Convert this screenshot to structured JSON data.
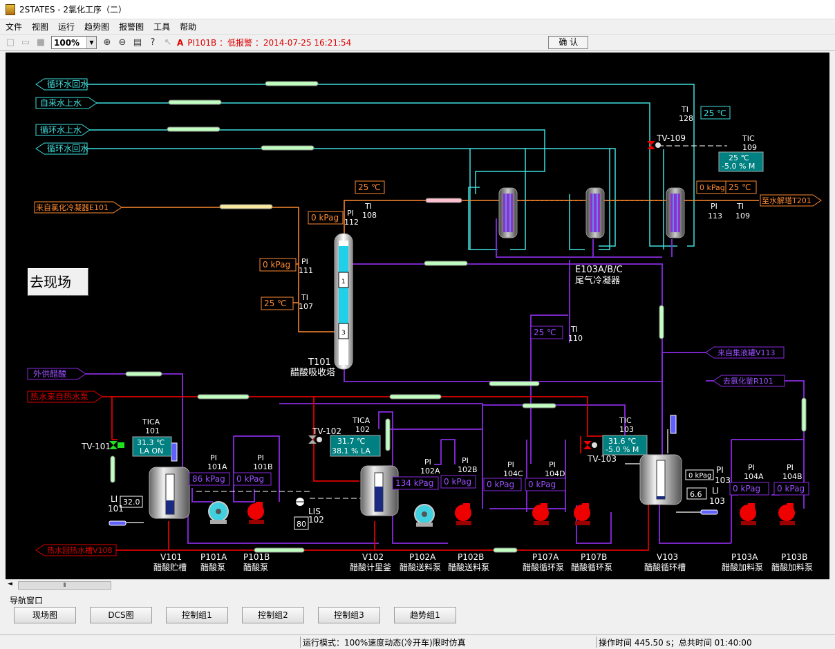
{
  "window": {
    "title": "2STATES - 2氯化工序（二）"
  },
  "menu": [
    "文件",
    "视图",
    "运行",
    "趋势图",
    "报警图",
    "工具",
    "帮助"
  ],
  "toolbar": {
    "zoom": "100%",
    "alarm_mark": "A",
    "alarm_text": "PI101B ：低报警 ：2014-07-25 16:21:54",
    "confirm": "确 认"
  },
  "goto_button": "去现场",
  "streams": {
    "cw_return_1": "循环水回水",
    "tap_water": "自来水上水",
    "cw_supply": "循环水上水",
    "cw_return_2": "循环水回水",
    "from_cond": "来自氯化冷凝器E101",
    "to_desorb": "至水解塔T201",
    "from_v113": "来自集液罐V113",
    "to_r101": "去氯化釜R101",
    "ext_acid": "外供醋酸",
    "hot_in": "热水来自热水泵",
    "hot_out": "热水回热水槽V108"
  },
  "instruments": {
    "ti128": {
      "tag1": "TI",
      "tag2": "128",
      "value": "25 ℃"
    },
    "tv109": "TV-109",
    "tic109": {
      "tag1": "TIC",
      "tag2": "109",
      "value1": "25 ℃",
      "value2": "-5.0 % M"
    },
    "pi113": {
      "tag1": "PI",
      "tag2": "113",
      "value": "0 kPag"
    },
    "ti109": {
      "tag1": "TI",
      "tag2": "109",
      "value": "25 ℃"
    },
    "ti108": {
      "tag1": "TI",
      "tag2": "108",
      "value": "25 ℃"
    },
    "pi112": {
      "tag1": "PI",
      "tag2": "112",
      "value": "0 kPag"
    },
    "pi111": {
      "tag1": "PI",
      "tag2": "111",
      "value": "0 kPag"
    },
    "ti107": {
      "tag1": "TI",
      "tag2": "107",
      "value": "25 ℃"
    },
    "ti110": {
      "tag1": "TI",
      "tag2": "110",
      "value": "25 ℃"
    },
    "tica101": {
      "tag1": "TICA",
      "tag2": "101",
      "value1": "31.3 ℃",
      "value2": "LA ON"
    },
    "tv101": "TV-101",
    "pi101a": {
      "tag1": "PI",
      "tag2": "101A",
      "value": "86 kPag"
    },
    "pi101b": {
      "tag1": "PI",
      "tag2": "101B",
      "value": "0 kPag"
    },
    "li101": {
      "tag1": "LI",
      "tag2": "101",
      "value": "32.0"
    },
    "tv102": "TV-102",
    "tica102": {
      "tag1": "TICA",
      "tag2": "102",
      "value1": "31.7 ℃",
      "value2": "38.1 % LA"
    },
    "lis102": {
      "tag1": "LIS",
      "tag2": "102",
      "value": "80"
    },
    "pi102a": {
      "tag1": "PI",
      "tag2": "102A",
      "value": "134 kPag"
    },
    "pi102b": {
      "tag1": "PI",
      "tag2": "102B",
      "value": "0 kPag"
    },
    "pi104c": {
      "tag1": "PI",
      "tag2": "104C",
      "value": "0 kPag"
    },
    "pi104d": {
      "tag1": "PI",
      "tag2": "104D",
      "value": "0 kPag"
    },
    "tic103": {
      "tag1": "TIC",
      "tag2": "103",
      "value1": "31.6 ℃",
      "value2": "-5.0 % M"
    },
    "tv103": "TV-103",
    "pi103": {
      "tag1": "PI",
      "tag2": "103",
      "value": "0 kPag"
    },
    "li103": {
      "tag1": "LI",
      "tag2": "103",
      "value": "6.6"
    },
    "pi104a": {
      "tag1": "PI",
      "tag2": "104A",
      "value": "0 kPag"
    },
    "pi104b": {
      "tag1": "PI",
      "tag2": "104B",
      "value": "0 kPag"
    }
  },
  "equipment": {
    "t101": {
      "tag": "T101",
      "name": "醋酸吸收塔",
      "seg1": "1",
      "seg3": "3"
    },
    "e103": {
      "tag": "E103A/B/C",
      "name": "尾气冷凝器"
    },
    "v101": {
      "tag": "V101",
      "name": "醋酸贮槽"
    },
    "p101a": {
      "tag": "P101A",
      "name": "醋酸泵"
    },
    "p101b": {
      "tag": "P101B",
      "name": "醋酸泵"
    },
    "v102": {
      "tag": "V102",
      "name": "醋酸计里釜"
    },
    "p102a": {
      "tag": "P102A",
      "name": "醋酸送料泵"
    },
    "p102b": {
      "tag": "P102B",
      "name": "醋酸送料泵"
    },
    "p107a": {
      "tag": "P107A",
      "name": "醋酸循环泵"
    },
    "p107b": {
      "tag": "P107B",
      "name": "醋酸循环泵"
    },
    "v103": {
      "tag": "V103",
      "name": "醋酸循环槽"
    },
    "p103a": {
      "tag": "P103A",
      "name": "醋酸加料泵"
    },
    "p103b": {
      "tag": "P103B",
      "name": "醋酸加料泵"
    }
  },
  "nav": {
    "label": "导航窗口",
    "buttons": [
      "现场图",
      "DCS图",
      "控制组1",
      "控制组2",
      "控制组3",
      "趋势组1"
    ]
  },
  "status": {
    "mode": "运行模式：100%速度动态(冷开车)限时仿真",
    "time": "操作时间 445.50 s；总共时间 01:40:00"
  }
}
